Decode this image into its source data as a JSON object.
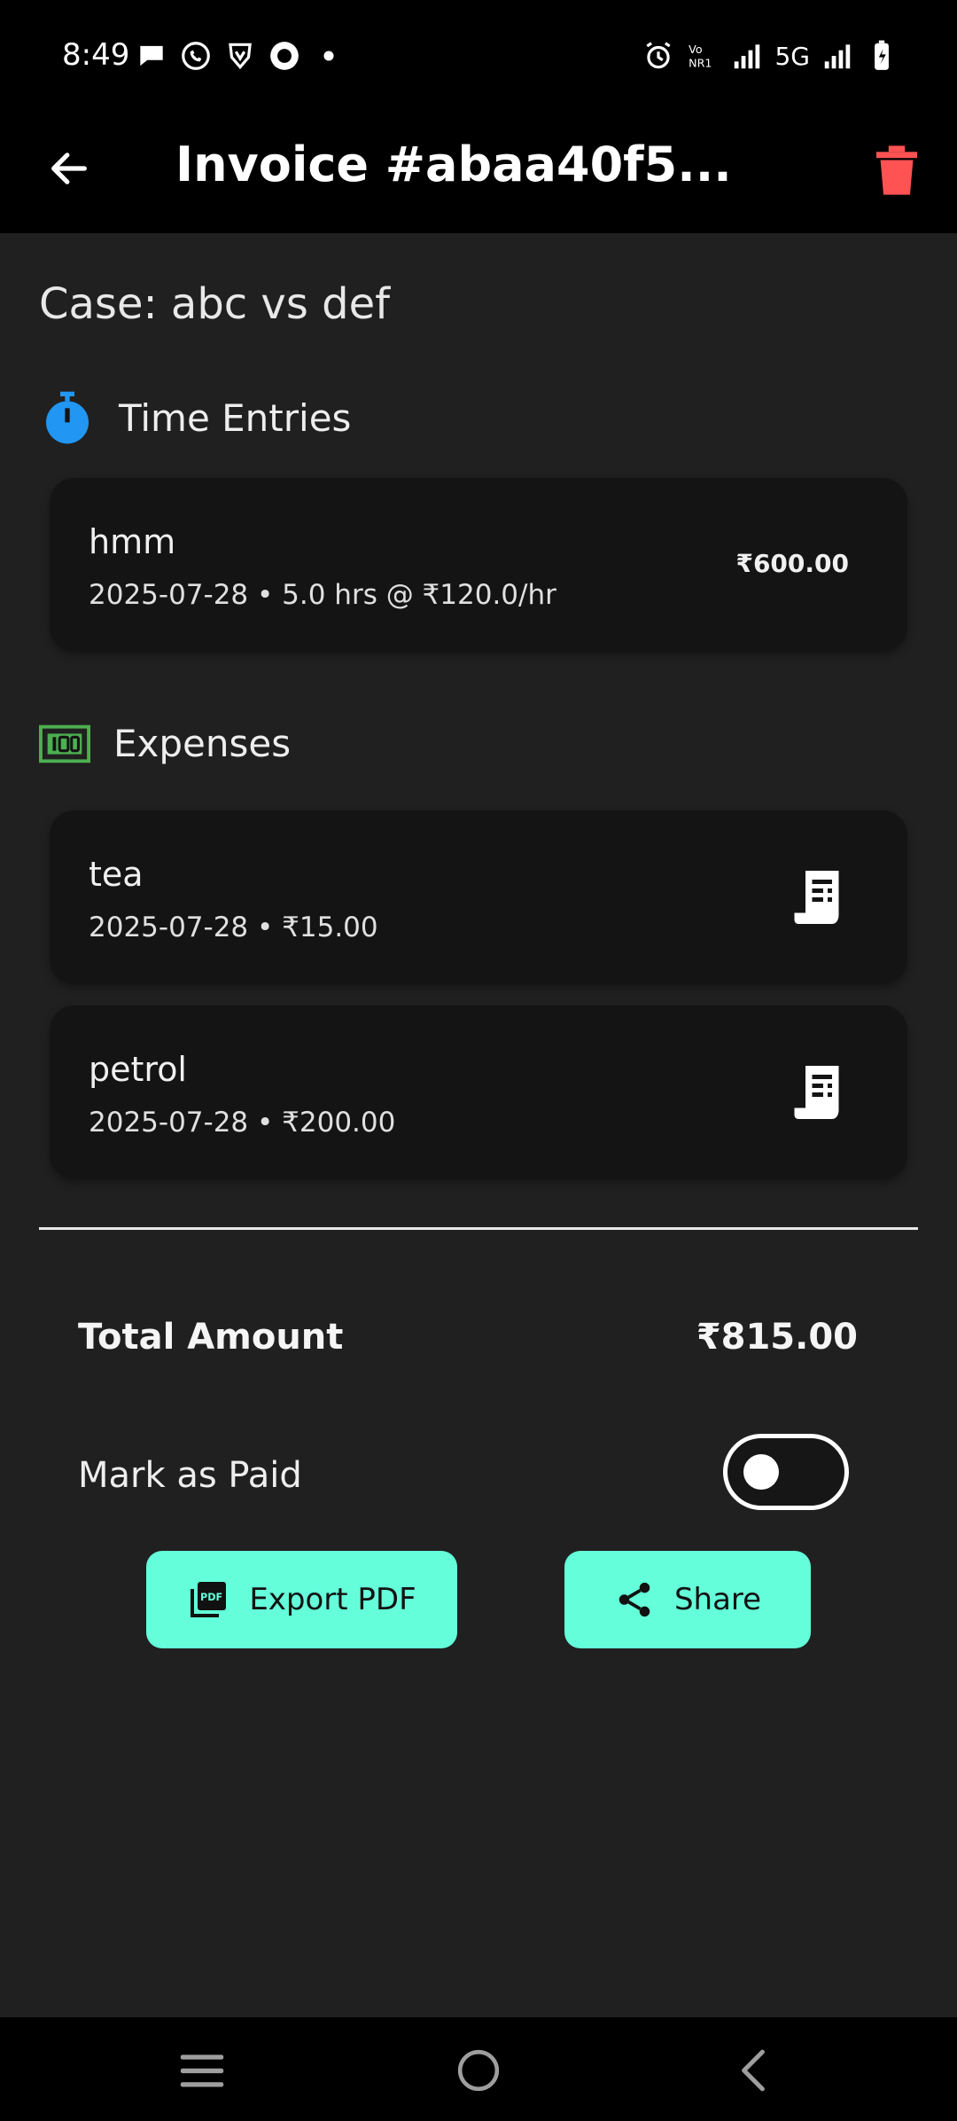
{
  "status_bar": {
    "time": "8:49",
    "network_label": "5G"
  },
  "app_bar": {
    "title": "Invoice #abaa40f5..."
  },
  "case": {
    "title": "Case: abc vs def"
  },
  "time_entries": {
    "heading": "Time Entries",
    "items": [
      {
        "title": "hmm",
        "subtitle": "2025-07-28 • 5.0 hrs @ ₹120.0/hr",
        "amount": "₹600.00"
      }
    ]
  },
  "expenses": {
    "heading": "Expenses",
    "items": [
      {
        "title": "tea",
        "subtitle": "2025-07-28 • ₹15.00"
      },
      {
        "title": "petrol",
        "subtitle": "2025-07-28 • ₹200.00"
      }
    ]
  },
  "summary": {
    "total_label": "Total Amount",
    "total_value": "₹815.00"
  },
  "paid": {
    "label": "Mark as Paid",
    "is_paid": false
  },
  "actions": {
    "export_label": "Export PDF",
    "share_label": "Share"
  },
  "colors": {
    "accent": "#64ffda",
    "delete": "#ff5252",
    "timer_icon": "#2196f3",
    "expense_icon": "#4caf50",
    "background": "#202020",
    "card": "#141414"
  },
  "icons": {
    "back": "arrow-left-icon",
    "delete": "trash-icon",
    "time_entries": "stopwatch-icon",
    "expenses": "money-icon",
    "receipt": "receipt-icon",
    "export": "pdf-icon",
    "share": "share-icon"
  }
}
